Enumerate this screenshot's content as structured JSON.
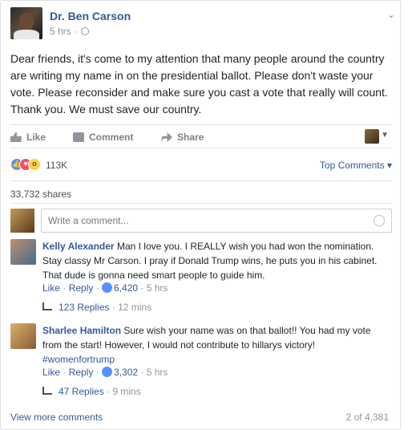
{
  "post": {
    "author": "Dr. Ben Carson",
    "time": "5 hrs",
    "separator": "·",
    "text": "Dear friends, it's come to my attention that many people around the country are writing my name in on the presidential ballot. Please don't waste your vote. Please reconsider and make sure you cast a vote that really will count. Thank you. We must save our country."
  },
  "actions": {
    "like": "Like",
    "comment": "Comment",
    "share": "Share"
  },
  "reactions": {
    "count": "113K",
    "top_comments": "Top Comments",
    "top_comments_caret": "▾"
  },
  "shares": "33,732 shares",
  "composer": {
    "placeholder": "Write a comment..."
  },
  "comments": [
    {
      "name": "Kelly Alexander",
      "text": "Man I love you. I REALLY wish you had won the nomination. Stay classy Mr Carson. I pray if Donald Trump wins, he puts you in his cabinet. That dude is gonna need smart people to guide him.",
      "like": "Like",
      "reply": "Reply",
      "likes": "6,420",
      "time": "5 hrs",
      "replies": "123 Replies",
      "replies_time": "12 mins"
    },
    {
      "name": "Sharlee Hamilton",
      "text": "Sure wish your name was on that ballot!! You had my vote from the start! However, I would not contribute to hillarys victory!",
      "tag": "#womenfortrump",
      "like": "Like",
      "reply": "Reply",
      "likes": "3,302",
      "time": "5 hrs",
      "replies": "47 Replies",
      "replies_time": "9 mins"
    }
  ],
  "footer": {
    "view_more": "View more comments",
    "count": "2 of 4,381"
  }
}
